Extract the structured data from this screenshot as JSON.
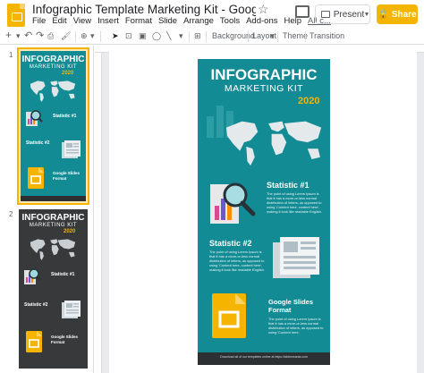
{
  "window": {
    "doc_title": "Infographic Template Marketing Kit - Google Slides Form...",
    "menu": [
      "File",
      "Edit",
      "View",
      "Insert",
      "Format",
      "Slide",
      "Arrange",
      "Tools",
      "Add-ons",
      "Help",
      "All c..."
    ],
    "present_label": "Present",
    "share_label": "Share"
  },
  "toolbar": {
    "background_label": "Background",
    "layout_label": "Layout",
    "theme_label": "Theme",
    "transition_label": "Transition"
  },
  "filmstrip": {
    "slide_numbers": [
      "1",
      "2"
    ]
  },
  "slide": {
    "title": "INFOGRAPHIC",
    "subtitle": "MARKETING KIT",
    "year": "2020",
    "stat1_heading": "Statistic #1",
    "stat1_body": "The point of using Lorem Ipsum is that it has a more-or-less normal distribution of letters, as opposed to using 'Content here, content here', making it look like readable English.",
    "stat2_heading": "Statistic #2",
    "stat2_body": "The point of using Lorem Ipsum is that it has a more-or-less normal distribution of letters, as opposed to using 'Content here, content here', making it look like readable English.",
    "feature_heading": "Google Slides Format",
    "feature_body": "The point of using Lorem Ipsum is that it has a more-or-less normal distribution of letters, as opposed to using 'Content here.",
    "footer": "Download all of our templates online at https://slidesmania.com"
  },
  "colors": {
    "teal": "#138b94",
    "dark": "#37393b",
    "accent": "#f4b400"
  }
}
